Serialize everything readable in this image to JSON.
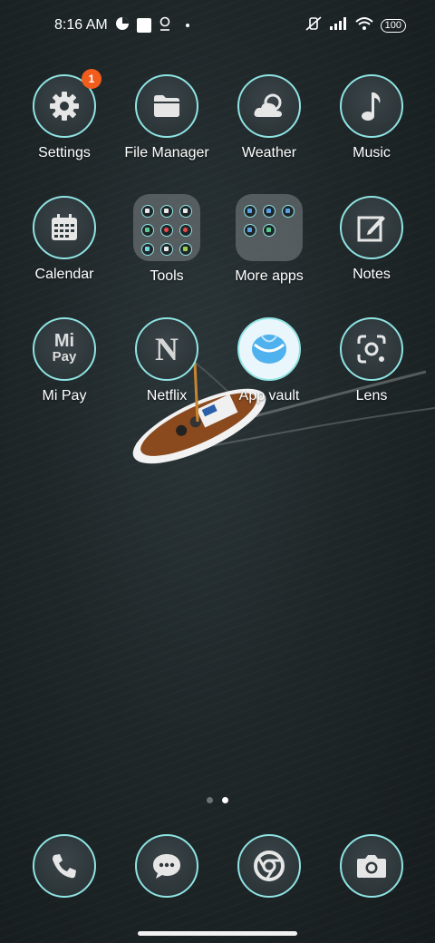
{
  "status_bar": {
    "time": "8:16 AM",
    "battery": "100",
    "icons": [
      "data-saver-icon",
      "notification-square-icon",
      "location-pin-icon",
      "more-dot-icon",
      "mute-icon",
      "signal-icon",
      "wifi-icon",
      "battery-icon"
    ]
  },
  "apps": {
    "settings": {
      "label": "Settings",
      "badge": "1",
      "icon": "gear-icon"
    },
    "file_manager": {
      "label": "File Manager",
      "icon": "folder-icon"
    },
    "weather": {
      "label": "Weather",
      "icon": "cloud-sun-icon"
    },
    "music": {
      "label": "Music",
      "icon": "music-note-icon"
    },
    "calendar": {
      "label": "Calendar",
      "icon": "calendar-icon"
    },
    "tools": {
      "label": "Tools",
      "icon": "folder-grid"
    },
    "more_apps": {
      "label": "More apps",
      "icon": "folder-grid"
    },
    "notes": {
      "label": "Notes",
      "icon": "edit-note-icon"
    },
    "mi_pay": {
      "label": "Mi Pay",
      "logo_top": "Mi",
      "logo_bottom": "Pay"
    },
    "netflix": {
      "label": "Netflix",
      "logo": "N"
    },
    "app_vault": {
      "label": "App vault",
      "icon": "app-vault-icon"
    },
    "lens": {
      "label": "Lens",
      "icon": "lens-icon"
    }
  },
  "dock": {
    "phone": {
      "icon": "phone-icon"
    },
    "messages": {
      "icon": "message-icon"
    },
    "chrome": {
      "icon": "chrome-icon"
    },
    "camera": {
      "icon": "camera-icon"
    }
  },
  "page_indicator": {
    "pages": 2,
    "current": 2
  },
  "colors": {
    "accent_ring": "#8fe3e3",
    "badge": "#f25c1c"
  }
}
